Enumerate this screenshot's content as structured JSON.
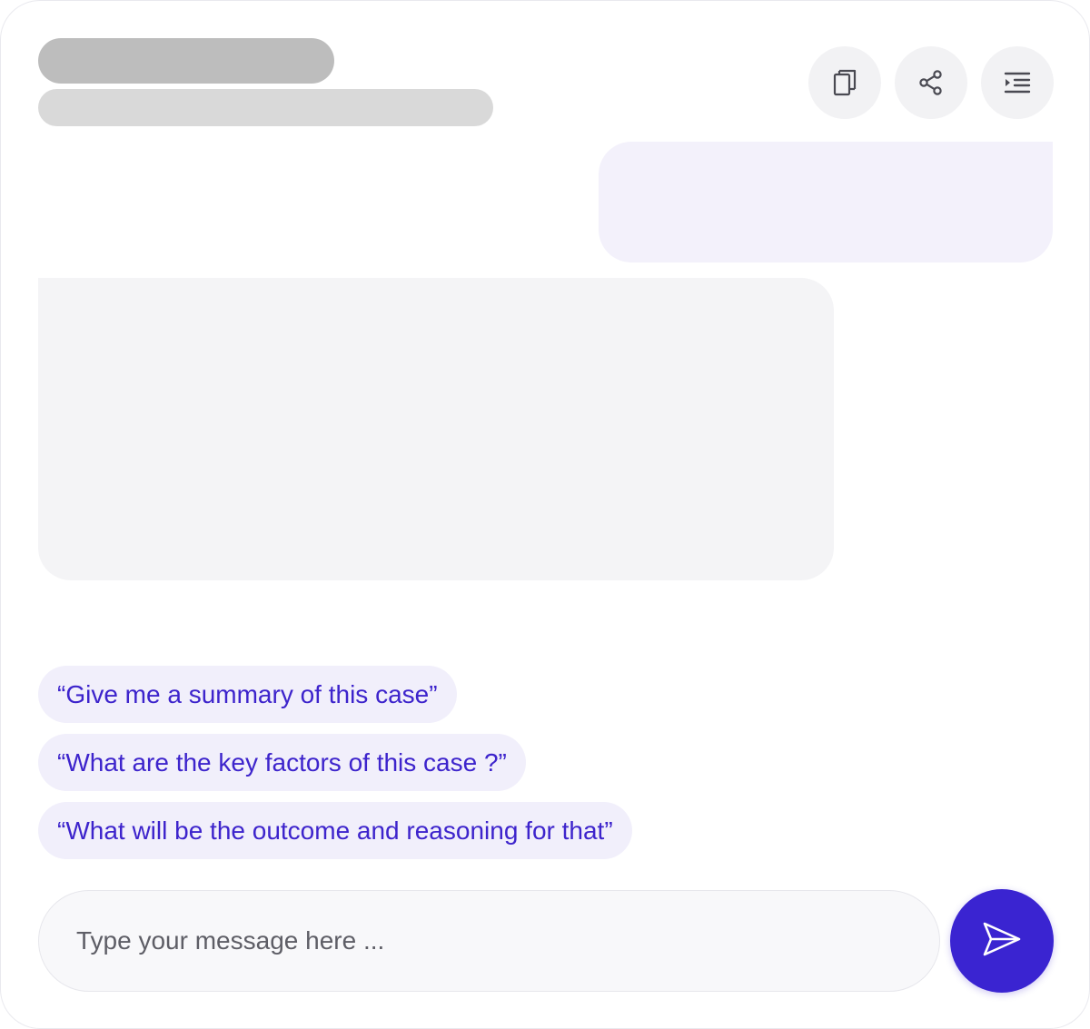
{
  "header": {
    "actions": [
      {
        "icon": "copy-icon",
        "label": ""
      },
      {
        "icon": "share-icon",
        "label": ""
      },
      {
        "icon": "indent-menu-icon",
        "label": ""
      }
    ]
  },
  "suggestions": [
    "“Give me a summary of this case”",
    "“What are the key factors of this case ?”",
    "“What will be the outcome and reasoning for that”"
  ],
  "composer": {
    "placeholder": "Type your message here ...",
    "value": "",
    "send_icon": "send-icon"
  },
  "colors": {
    "accent": "#3a24d1",
    "suggestion_text": "#3d24cc",
    "suggestion_bg": "#f1effb",
    "user_bubble": "#f3f1fb",
    "bot_bubble": "#f4f4f6"
  }
}
